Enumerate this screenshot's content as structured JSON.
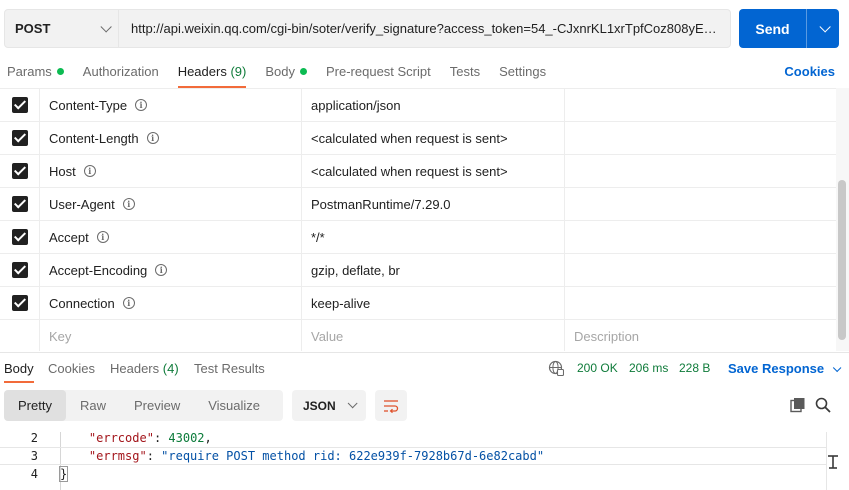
{
  "request": {
    "method": "POST",
    "url": "http://api.weixin.qq.com/cgi-bin/soter/verify_signature?access_token=54_-CJxnrKL1xrTpfCoz808yEm(",
    "send_label": "Send"
  },
  "request_tabs": [
    {
      "label": "Params",
      "dot": true
    },
    {
      "label": "Authorization"
    },
    {
      "label": "Headers",
      "count": "(9)",
      "active": true
    },
    {
      "label": "Body",
      "dot": true
    },
    {
      "label": "Pre-request Script"
    },
    {
      "label": "Tests"
    },
    {
      "label": "Settings"
    }
  ],
  "cookies_label": "Cookies",
  "headers": [
    {
      "key": "Content-Type",
      "value": "application/json"
    },
    {
      "key": "Content-Length",
      "value": "<calculated when request is sent>"
    },
    {
      "key": "Host",
      "value": "<calculated when request is sent>"
    },
    {
      "key": "User-Agent",
      "value": "PostmanRuntime/7.29.0"
    },
    {
      "key": "Accept",
      "value": "*/*"
    },
    {
      "key": "Accept-Encoding",
      "value": "gzip, deflate, br"
    },
    {
      "key": "Connection",
      "value": "keep-alive"
    }
  ],
  "new_row": {
    "key": "Key",
    "value": "Value",
    "description": "Description"
  },
  "response_tabs": {
    "body": "Body",
    "cookies": "Cookies",
    "headers": "Headers",
    "headers_count": "(4)",
    "test_results": "Test Results"
  },
  "status": {
    "code": "200 OK",
    "time": "206 ms",
    "size": "228 B"
  },
  "save_response_label": "Save Response",
  "view_modes": [
    "Pretty",
    "Raw",
    "Preview",
    "Visualize"
  ],
  "format": "JSON",
  "code": {
    "line_numbers": [
      "2",
      "3",
      "4"
    ],
    "line2_key": "\"errcode\"",
    "line2_value": "43002",
    "line3_key": "\"errmsg\"",
    "line3_value": "\"require POST method rid: 622e939f-7928b67d-6e82cabd\"",
    "line4": "}"
  },
  "colors": {
    "accent": "#0265d2",
    "tab_underline": "#f26b3a",
    "status_green": "#0f7b3a"
  }
}
